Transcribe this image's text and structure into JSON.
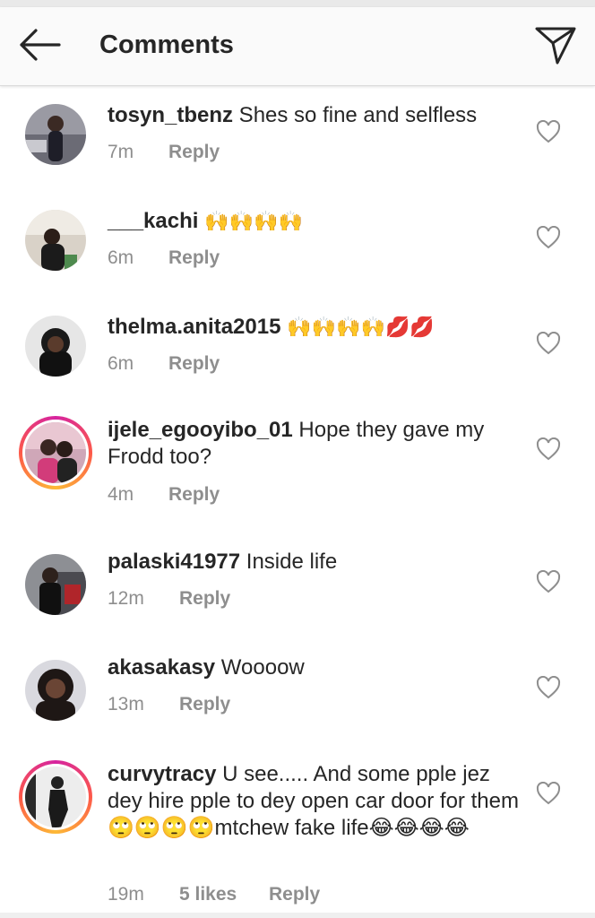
{
  "header": {
    "title": "Comments"
  },
  "comments": [
    {
      "username": "tosyn_tbenz",
      "text": " Shes so fine and selfless",
      "time": "7m",
      "likes": "",
      "reply": "Reply",
      "story": false
    },
    {
      "username": "___kachi",
      "text": " 🙌🙌🙌🙌",
      "time": "6m",
      "likes": "",
      "reply": "Reply",
      "story": false
    },
    {
      "username": "thelma.anita2015",
      "text": " 🙌🙌🙌🙌💋💋",
      "time": "6m",
      "likes": "",
      "reply": "Reply",
      "story": false
    },
    {
      "username": "ijele_egooyibo_01",
      "text": " Hope they gave my Frodd too?",
      "time": "4m",
      "likes": "",
      "reply": "Reply",
      "story": true
    },
    {
      "username": "palaski41977",
      "text": " Inside life",
      "time": "12m",
      "likes": "",
      "reply": "Reply",
      "story": false
    },
    {
      "username": "akasakasy",
      "text": " Woooow",
      "time": "13m",
      "likes": "",
      "reply": "Reply",
      "story": false
    },
    {
      "username": "curvytracy",
      "text": " U see..... And some pple jez dey hire pple to dey open car door for them 🙄🙄🙄🙄mtchew fake life😂😂😂😂",
      "time": "19m",
      "likes": "5 likes",
      "reply": "Reply",
      "story": true
    }
  ],
  "icons": {
    "back": "arrow-left-icon",
    "share": "direct-send-icon",
    "like": "heart-outline-icon"
  },
  "colors": {
    "story_ring_start": "#d6249f",
    "story_ring_end": "#fdb936",
    "meta_gray": "#8e8e8e",
    "text": "#262626"
  }
}
